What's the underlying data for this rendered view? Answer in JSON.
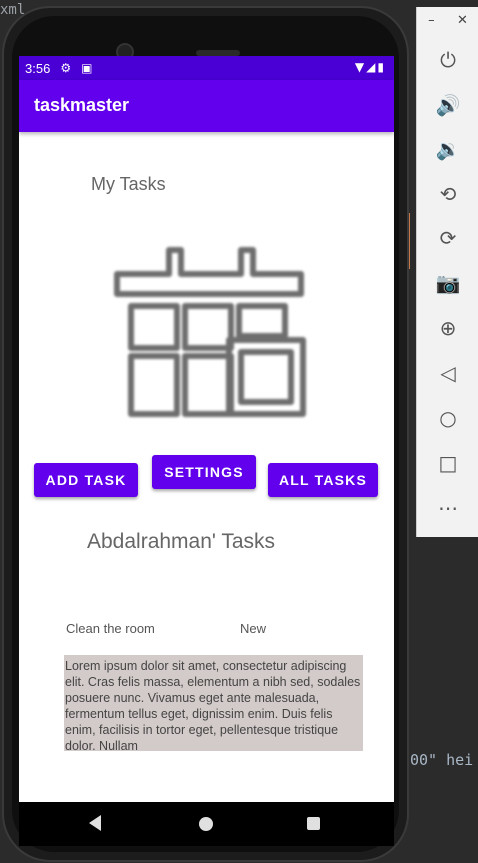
{
  "ide": {
    "top_fragment": "xml",
    "bottom_fragment": "00\" hei"
  },
  "status_bar": {
    "time": "3:56",
    "left_icons": [
      "gear-icon",
      "a-icon"
    ],
    "right_icons": [
      "wifi-icon",
      "signal-icon",
      "battery-icon"
    ]
  },
  "app_bar": {
    "title": "taskmaster"
  },
  "main": {
    "heading": "My Tasks",
    "illustration": "calendar-grid-icon",
    "buttons": {
      "add_task": "ADD TASK",
      "settings": "SETTINGS",
      "all_tasks": "ALL TASKS"
    },
    "user_tasks_heading": "Abdalrahman' Tasks",
    "tasks": [
      {
        "title": "Clean the room",
        "state": "New"
      }
    ],
    "description": "Lorem ipsum dolor sit amet, consectetur adipiscing elit. Cras felis massa, elementum a nibh sed, sodales posuere nunc. Vivamus eget ante malesuada, fermentum tellus eget, dignissim enim. Duis felis enim, facilisis in tortor eget, pellentesque tristique dolor. Nullam"
  },
  "emulator_panel": {
    "window_controls": [
      "minimize-icon",
      "close-icon"
    ],
    "buttons": [
      "power-icon",
      "volume-up-icon",
      "volume-down-icon",
      "rotate-left-icon",
      "rotate-right-icon",
      "camera-icon",
      "zoom-icon",
      "back-icon",
      "home-icon",
      "overview-icon",
      "more-icon"
    ]
  },
  "colors": {
    "primary": "#6200ee",
    "primary_dark": "#4a00d4",
    "description_bg": "#d3cbc9"
  }
}
